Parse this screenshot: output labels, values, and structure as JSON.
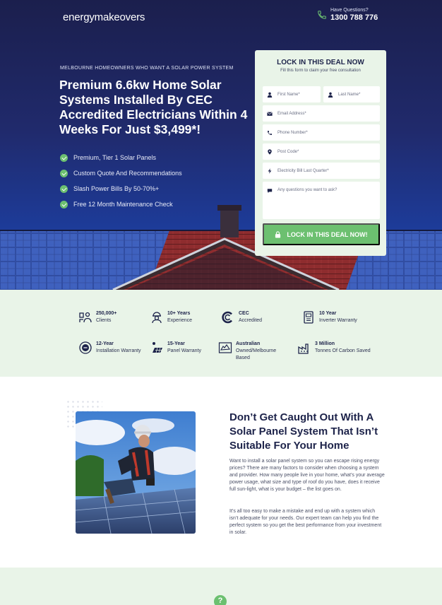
{
  "header": {
    "logo": "energymakeovers",
    "phone_label": "Have Questions?",
    "phone_number": "1300 788 776"
  },
  "hero": {
    "kicker": "MELBOURNE HOMEOWNERS WHO WANT A SOLAR POWER SYSTEM",
    "headline": "Premium 6.6kw Home Solar Systems Installed By CEC Accredited Electricians Within 4 Weeks For Just $3,499*!",
    "checks": [
      "Premium, Tier 1 Solar Panels",
      "Custom Quote And Recommendations",
      "Slash Power Bills By 50-70%+",
      "Free 12 Month Maintenance Check"
    ]
  },
  "form": {
    "title": "LOCK IN THIS DEAL NOW",
    "subtitle": "Fill this form to claim your free consultation",
    "first_name": "First Name*",
    "last_name": "Last Name*",
    "email": "Email Address*",
    "phone": "Phone Number*",
    "postcode": "Post Code*",
    "bill": "Electricity Bill Last Quarter*",
    "questions": "Any questions you want to ask?",
    "submit": "LOCK IN THIS DEAL NOW!"
  },
  "stats": [
    {
      "bold": "250,000+",
      "text": "Clients",
      "icon": "users-icon"
    },
    {
      "bold": "10+ Years",
      "text": "Experience",
      "icon": "worker-icon"
    },
    {
      "bold": "CEC",
      "text": "Accredited",
      "icon": "cec-logo-icon"
    },
    {
      "bold": "10 Year",
      "text": "Inverter Warranty",
      "icon": "inverter-icon"
    },
    {
      "bold": "12-Year",
      "text": "Installation Warranty",
      "icon": "warranty-badge-icon"
    },
    {
      "bold": "15-Year",
      "text": "Panel Warranty",
      "icon": "solar-panel-icon"
    },
    {
      "bold": "Australian",
      "text": "Owned/Melbourne Based",
      "icon": "australia-map-icon"
    },
    {
      "bold": "3 Million",
      "text": "Tonnes Of Carbon Saved",
      "icon": "factory-icon"
    }
  ],
  "content": {
    "heading": "Don’t Get Caught Out With A Solar Panel System That Isn’t Suitable For Your Home",
    "paragraph1": "Want to install a solar panel system so you can escape rising energy prices? There are many factors to consider when choosing a system and provider. How many people live in your home, what’s your average power usage, what size and type of roof do you have, does it receive full sun-light, what is your budget – the list goes on.",
    "paragraph2": "It’s all too easy to make a mistake and end up with a system which isn’t adequate for your needs. Our expert team can help you find the perfect system so you get the best performance from your investment in solar."
  },
  "help_glyph": "?",
  "colors": {
    "navy": "#1d234a",
    "green": "#6cc070",
    "mint": "#e9f4e8"
  }
}
